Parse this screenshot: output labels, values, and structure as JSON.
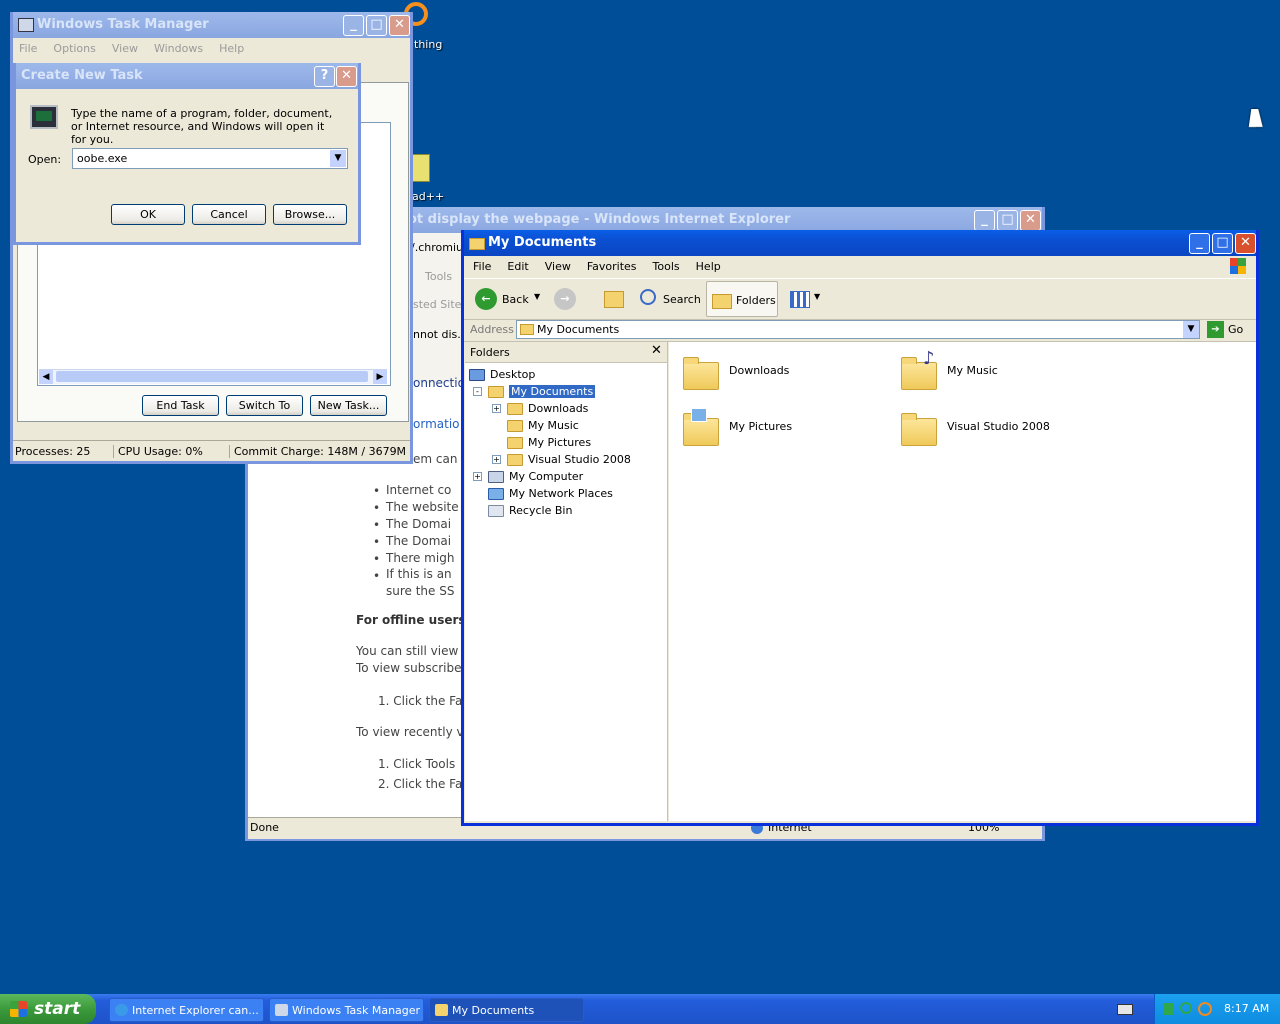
{
  "desktop": {
    "icon_labels": [
      "thing",
      "ad++"
    ]
  },
  "task_manager": {
    "title": "Windows Task Manager",
    "menu": [
      "File",
      "Options",
      "View",
      "Windows",
      "Help"
    ],
    "buttons": {
      "end_task": "End Task",
      "switch_to": "Switch To",
      "new_task": "New Task..."
    },
    "status": {
      "processes": "Processes: 25",
      "cpu": "CPU Usage: 0%",
      "commit": "Commit Charge: 148M / 3679M"
    }
  },
  "create_task": {
    "title": "Create New Task",
    "description": "Type the name of a program, folder, document, or Internet resource, and Windows will open it for you.",
    "open_label": "Open:",
    "open_value": "oobe.exe",
    "buttons": {
      "ok": "OK",
      "cancel": "Cancel",
      "browse": "Browse..."
    }
  },
  "ie": {
    "title": "ot display the webpage - Windows Internet Explorer",
    "address_fragment": "/.chromiur",
    "tools_label": "Tools",
    "sites_label": "sted Sites",
    "tab_fragment": "nnot dis...",
    "connection_fragment": "onnectio",
    "information_fragment": "ormatio",
    "item_can": "em can",
    "bullets": [
      "Internet co",
      "The website",
      "The Domai",
      "The Domai",
      "There migh",
      "If this is an",
      "sure the SS"
    ],
    "offline_heading": "For offline users",
    "offline_text": [
      "You can still view",
      "To view subscribe"
    ],
    "step_a": "1.  Click the Fa",
    "recent_text": "To view recently v",
    "steps_b": [
      "1.  Click Tools",
      "2.  Click the Fa"
    ],
    "status": {
      "done": "Done",
      "zone": "Internet",
      "zoom": "100%"
    }
  },
  "explorer": {
    "title": "My Documents",
    "menu": [
      "File",
      "Edit",
      "View",
      "Favorites",
      "Tools",
      "Help"
    ],
    "toolbar": {
      "back": "Back",
      "search": "Search",
      "folders": "Folders"
    },
    "address_label": "Address",
    "address_value": "My Documents",
    "go": "Go",
    "folders_pane_title": "Folders",
    "tree": [
      {
        "label": "Desktop",
        "level": 0,
        "expander": ""
      },
      {
        "label": "My Documents",
        "level": 1,
        "expander": "-",
        "selected": true
      },
      {
        "label": "Downloads",
        "level": 2,
        "expander": "+"
      },
      {
        "label": "My Music",
        "level": 2,
        "expander": ""
      },
      {
        "label": "My Pictures",
        "level": 2,
        "expander": ""
      },
      {
        "label": "Visual Studio 2008",
        "level": 2,
        "expander": "+"
      },
      {
        "label": "My Computer",
        "level": 1,
        "expander": "+"
      },
      {
        "label": "My Network Places",
        "level": 1,
        "expander": ""
      },
      {
        "label": "Recycle Bin",
        "level": 1,
        "expander": ""
      }
    ],
    "items": [
      "Downloads",
      "My Music",
      "My Pictures",
      "Visual Studio 2008"
    ]
  },
  "taskbar": {
    "start": "start",
    "tasks": [
      "Internet Explorer can...",
      "Windows Task Manager",
      "My Documents"
    ],
    "clock": "8:17 AM"
  },
  "colors": {
    "desktop": "#004e98",
    "title_active": "#0a5ee8",
    "taskbar": "#245edc",
    "start": "#3c9a3c"
  }
}
